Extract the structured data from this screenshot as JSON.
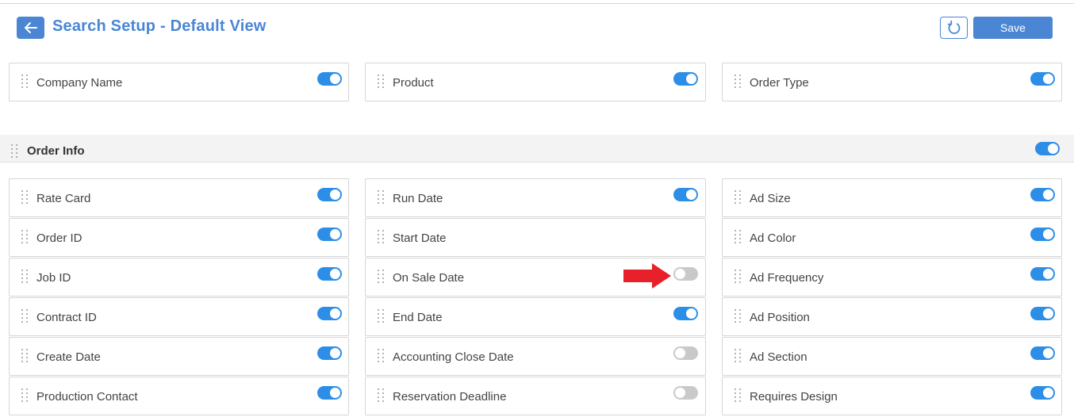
{
  "header": {
    "title": "Search Setup - Default View",
    "save_label": "Save"
  },
  "icons": {
    "back": "arrow-left-icon",
    "reset": "refresh-icon",
    "drag": "drag-handle-icon",
    "annotation": "red-arrow"
  },
  "colors": {
    "accent": "#4a86d4",
    "toggle_on": "#2d8ee8",
    "toggle_off": "#c9c9c9",
    "annotation": "#e8202a"
  },
  "top_fields": [
    {
      "label": "Company Name",
      "toggle": "on"
    },
    {
      "label": "Product",
      "toggle": "on"
    },
    {
      "label": "Order Type",
      "toggle": "on"
    }
  ],
  "section": {
    "title": "Order Info",
    "toggle": "on"
  },
  "fields": [
    [
      {
        "label": "Rate Card",
        "toggle": "on"
      },
      {
        "label": "Order ID",
        "toggle": "on"
      },
      {
        "label": "Job ID",
        "toggle": "on"
      },
      {
        "label": "Contract ID",
        "toggle": "on"
      },
      {
        "label": "Create Date",
        "toggle": "on"
      },
      {
        "label": "Production Contact",
        "toggle": "on"
      }
    ],
    [
      {
        "label": "Run Date",
        "toggle": "on"
      },
      {
        "label": "Start Date",
        "toggle": "none"
      },
      {
        "label": "On Sale Date",
        "toggle": "off"
      },
      {
        "label": "End Date",
        "toggle": "on"
      },
      {
        "label": "Accounting Close Date",
        "toggle": "off"
      },
      {
        "label": "Reservation Deadline",
        "toggle": "off"
      }
    ],
    [
      {
        "label": "Ad Size",
        "toggle": "on"
      },
      {
        "label": "Ad Color",
        "toggle": "on"
      },
      {
        "label": "Ad Frequency",
        "toggle": "on"
      },
      {
        "label": "Ad Position",
        "toggle": "on"
      },
      {
        "label": "Ad Section",
        "toggle": "on"
      },
      {
        "label": "Requires Design",
        "toggle": "on"
      }
    ]
  ]
}
